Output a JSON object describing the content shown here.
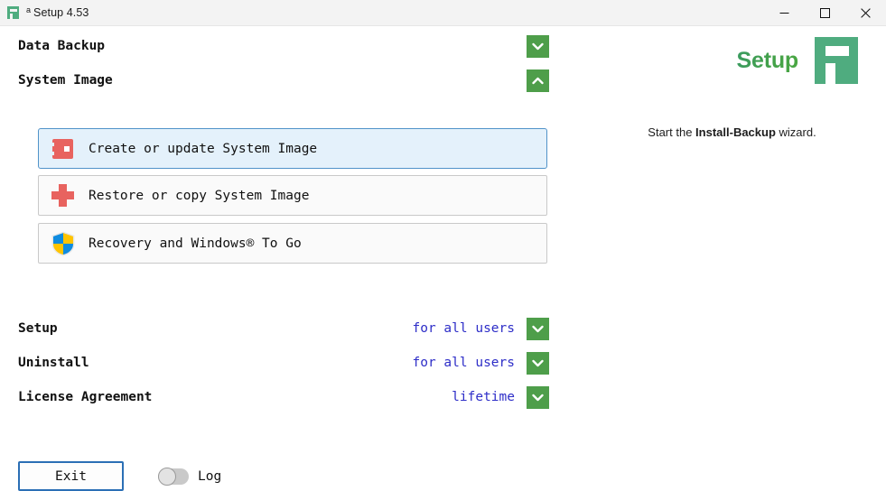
{
  "window": {
    "title_superscript": "a",
    "title": "Setup 4.53",
    "app_icon": "app-logo-icon",
    "controls": {
      "minimize": "minimize-icon",
      "maximize": "maximize-icon",
      "close": "close-icon"
    }
  },
  "brand": {
    "word": "Setup",
    "logo": "setup-logo-icon",
    "accent_color": "#3d9e56"
  },
  "hint": {
    "prefix": "Start the ",
    "strong": "Install-Backup",
    "suffix": " wizard."
  },
  "accordions": [
    {
      "label": "Data Backup",
      "expanded": false,
      "chevron": "chevron-down-icon"
    },
    {
      "label": "System Image",
      "expanded": true,
      "chevron": "chevron-up-icon"
    }
  ],
  "options": [
    {
      "label": "Create or update System Image",
      "icon": "drive-icon",
      "icon_color": "#e8635f",
      "selected": true
    },
    {
      "label": "Restore or copy System Image",
      "icon": "red-cross-icon",
      "icon_color": "#e8635f",
      "selected": false
    },
    {
      "label": "Recovery and Windows® To Go",
      "icon": "shield-icon",
      "icon_color": "#0f8ce0",
      "selected": false
    }
  ],
  "settings": [
    {
      "label": "Setup",
      "value": "for all users",
      "chevron": "chevron-down-icon"
    },
    {
      "label": "Uninstall",
      "value": "for all users",
      "chevron": "chevron-down-icon"
    },
    {
      "label": "License Agreement",
      "value": "lifetime",
      "chevron": "chevron-down-icon"
    }
  ],
  "footer": {
    "exit_label": "Exit",
    "log_label": "Log",
    "log_enabled": false
  },
  "colors": {
    "green_button": "#4e9e4a",
    "value_blue": "#2e2ec8",
    "selection_bg": "#e4f1fb",
    "selection_border": "#5193c9"
  }
}
